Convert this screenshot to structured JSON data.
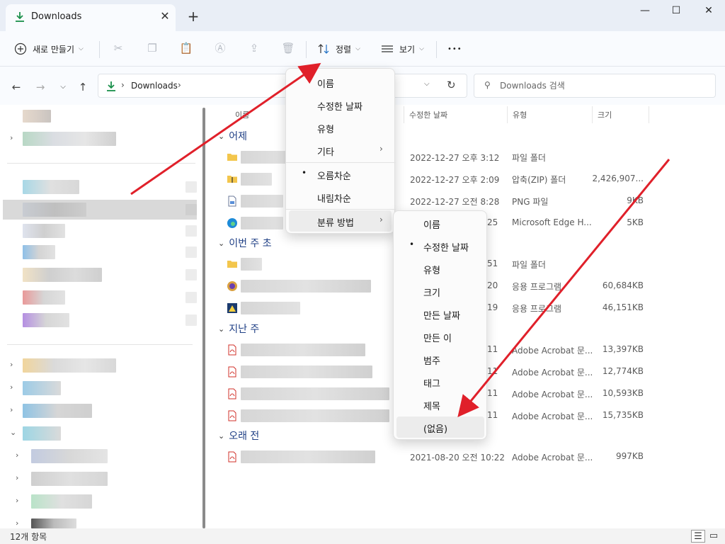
{
  "tab": {
    "title": "Downloads",
    "close": "✕",
    "new_tab": "+"
  },
  "window_controls": {
    "minimize": "—",
    "maximize": "☐",
    "close": "✕"
  },
  "toolbar": {
    "new_label": "새로 만들기",
    "sort_label": "정렬",
    "view_label": "보기",
    "more": "•••"
  },
  "addressbar": {
    "crumb": "Downloads",
    "separator": "›",
    "search_placeholder": "Downloads 검색"
  },
  "columns": {
    "name": "이름",
    "modified": "수정한 날짜",
    "type": "유형",
    "size": "크기"
  },
  "groups": [
    {
      "label": "어제"
    },
    {
      "label": "이번 주 초"
    },
    {
      "label": "지난 주"
    },
    {
      "label": "오래 전"
    }
  ],
  "files": [
    {
      "date": "2022-12-27 오후 3:12",
      "type": "파일 폴더",
      "size": "",
      "icon": "folder-icon"
    },
    {
      "date": "2022-12-27 오후 2:09",
      "type": "압축(ZIP) 폴더",
      "size": "2,426,907...",
      "icon": "zip-folder-icon"
    },
    {
      "date": "2022-12-27 오전 8:28",
      "type": "PNG 파일",
      "size": "9KB",
      "icon": "png-file-icon"
    },
    {
      "date": "25",
      "type": "Microsoft Edge H...",
      "size": "5KB",
      "icon": "edge-icon"
    },
    {
      "date": "51",
      "type": "파일 폴더",
      "size": "",
      "icon": "folder-icon"
    },
    {
      "date": "20",
      "type": "응용 프로그램",
      "size": "60,684KB",
      "icon": "app-icon"
    },
    {
      "date": "19",
      "type": "응용 프로그램",
      "size": "46,151KB",
      "icon": "app-icon"
    },
    {
      "date": "11",
      "type": "Adobe Acrobat 문...",
      "size": "13,397KB",
      "icon": "pdf-icon"
    },
    {
      "date": "11",
      "type": "Adobe Acrobat 문...",
      "size": "12,774KB",
      "icon": "pdf-icon"
    },
    {
      "date": "11",
      "type": "Adobe Acrobat 문...",
      "size": "10,593KB",
      "icon": "pdf-icon"
    },
    {
      "date": "11",
      "type": "Adobe Acrobat 문...",
      "size": "15,735KB",
      "icon": "pdf-icon"
    },
    {
      "date": "2021-08-20 오전 10:22",
      "type": "Adobe Acrobat 문...",
      "size": "997KB",
      "icon": "pdf-icon"
    }
  ],
  "sort_menu": {
    "items": [
      "이름",
      "수정한 날짜",
      "유형",
      "기타"
    ],
    "order": [
      "오름차순",
      "내림차순"
    ],
    "group_by": "분류 방법",
    "selected_order": "오름차순"
  },
  "groupby_menu": {
    "items": [
      "이름",
      "수정한 날짜",
      "유형",
      "크기",
      "만든 날짜",
      "만든 이",
      "범주",
      "태그",
      "제목",
      "(없음)"
    ],
    "selected": "수정한 날짜",
    "hovered": "(없음)"
  },
  "status": {
    "count": "12개 항목"
  },
  "colors": {
    "accent": "#1a8f4a",
    "group_heading": "#1f3f85",
    "arrow": "#e0202a",
    "pdf": "#d0302a"
  }
}
